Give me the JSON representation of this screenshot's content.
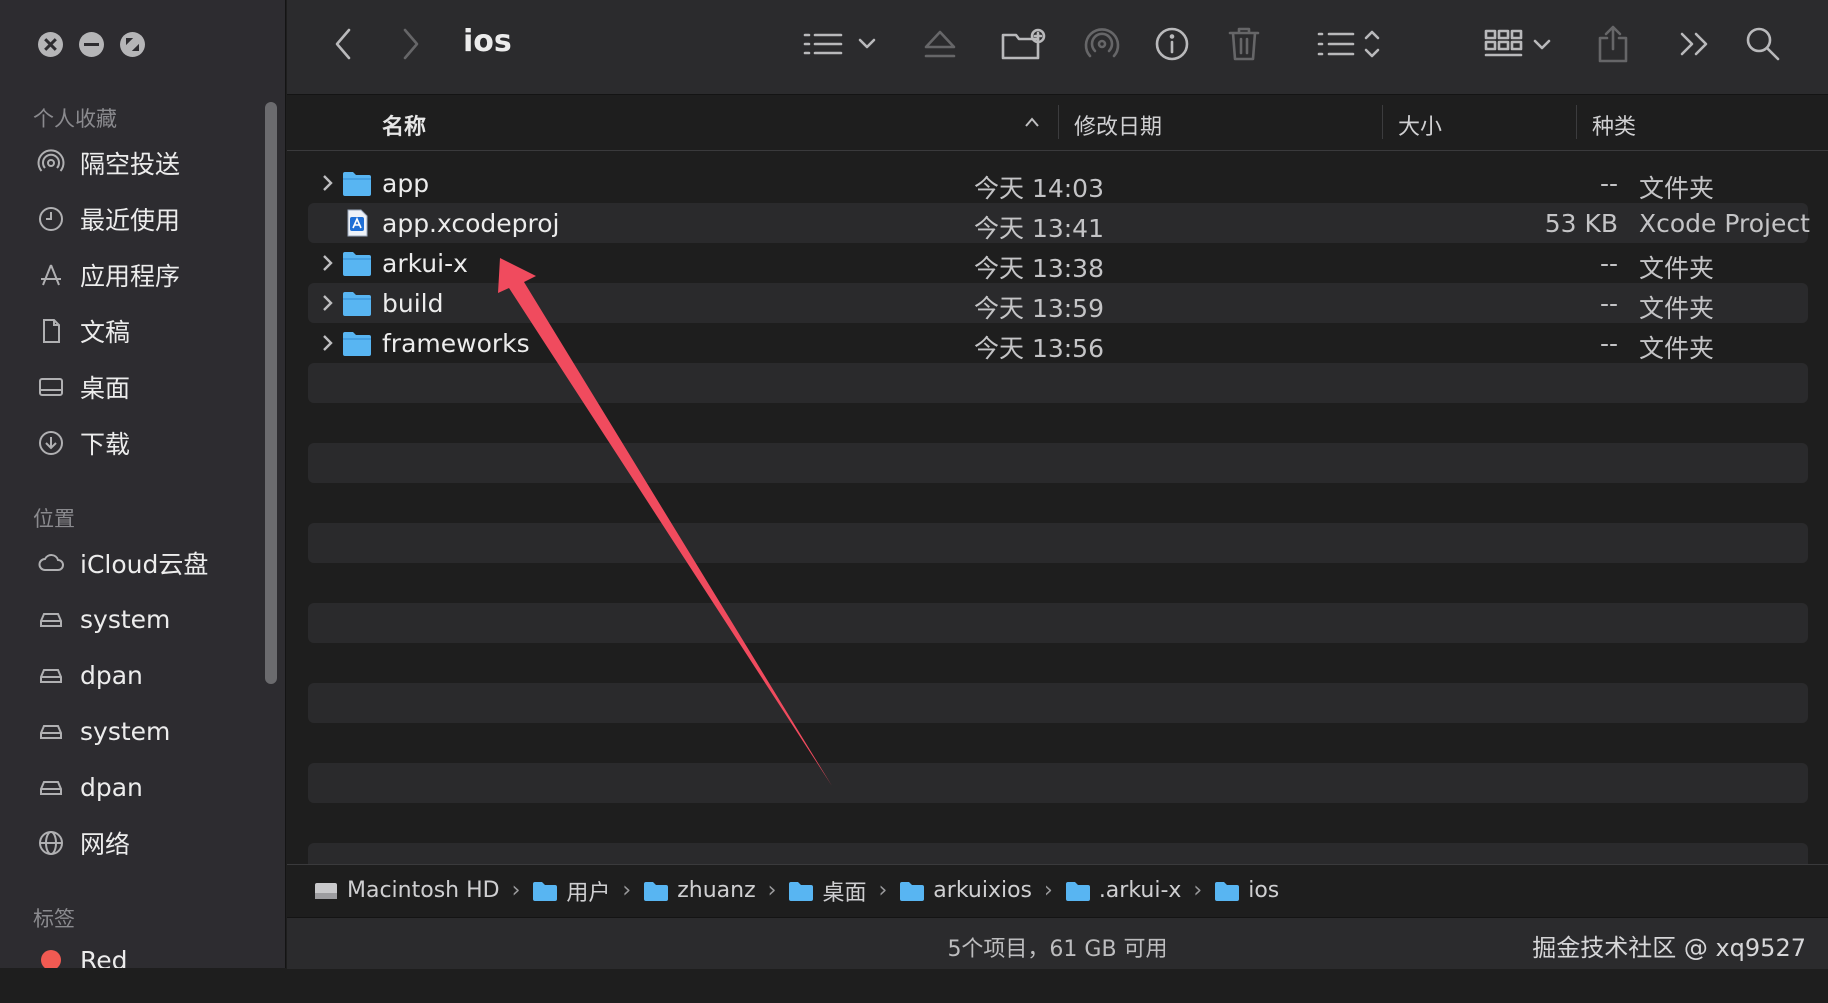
{
  "window": {
    "title": "ios"
  },
  "sidebar": {
    "favorites_label": "个人收藏",
    "favorites": [
      {
        "label": "隔空投送",
        "icon": "airdrop-icon"
      },
      {
        "label": "最近使用",
        "icon": "clock-icon"
      },
      {
        "label": "应用程序",
        "icon": "applications-icon"
      },
      {
        "label": "文稿",
        "icon": "document-icon"
      },
      {
        "label": "桌面",
        "icon": "desktop-icon"
      },
      {
        "label": "下载",
        "icon": "download-icon"
      }
    ],
    "locations_label": "位置",
    "locations": [
      {
        "label": "iCloud云盘",
        "icon": "cloud-icon"
      },
      {
        "label": "system",
        "icon": "drive-icon"
      },
      {
        "label": "dpan",
        "icon": "drive-icon"
      },
      {
        "label": "system",
        "icon": "drive-icon"
      },
      {
        "label": "dpan",
        "icon": "drive-icon"
      },
      {
        "label": "网络",
        "icon": "network-icon"
      }
    ],
    "tags_label": "标签",
    "tags": [
      {
        "label": "Red",
        "color": "#f25a52"
      }
    ]
  },
  "columns": {
    "name": "名称",
    "date": "修改日期",
    "size": "大小",
    "kind": "种类"
  },
  "files": [
    {
      "name": "app",
      "date": "今天 14:03",
      "size": "--",
      "kind": "文件夹",
      "type": "folder"
    },
    {
      "name": "app.xcodeproj",
      "date": "今天 13:41",
      "size": "53 KB",
      "kind": "Xcode Project",
      "type": "xcodeproj"
    },
    {
      "name": "arkui-x",
      "date": "今天 13:38",
      "size": "--",
      "kind": "文件夹",
      "type": "folder"
    },
    {
      "name": "build",
      "date": "今天 13:59",
      "size": "--",
      "kind": "文件夹",
      "type": "folder"
    },
    {
      "name": "frameworks",
      "date": "今天 13:56",
      "size": "--",
      "kind": "文件夹",
      "type": "folder"
    }
  ],
  "path": [
    "Macintosh HD",
    "用户",
    "zhuanz",
    "桌面",
    "arkuixios",
    ".arkui-x",
    "ios"
  ],
  "status": {
    "text": "5个项目，61 GB 可用"
  },
  "watermark": "掘金技术社区 @ xq9527",
  "colors": {
    "folder": "#58b5f2",
    "annotation_arrow": "#f04b5e",
    "tag_red": "#f25a52"
  }
}
